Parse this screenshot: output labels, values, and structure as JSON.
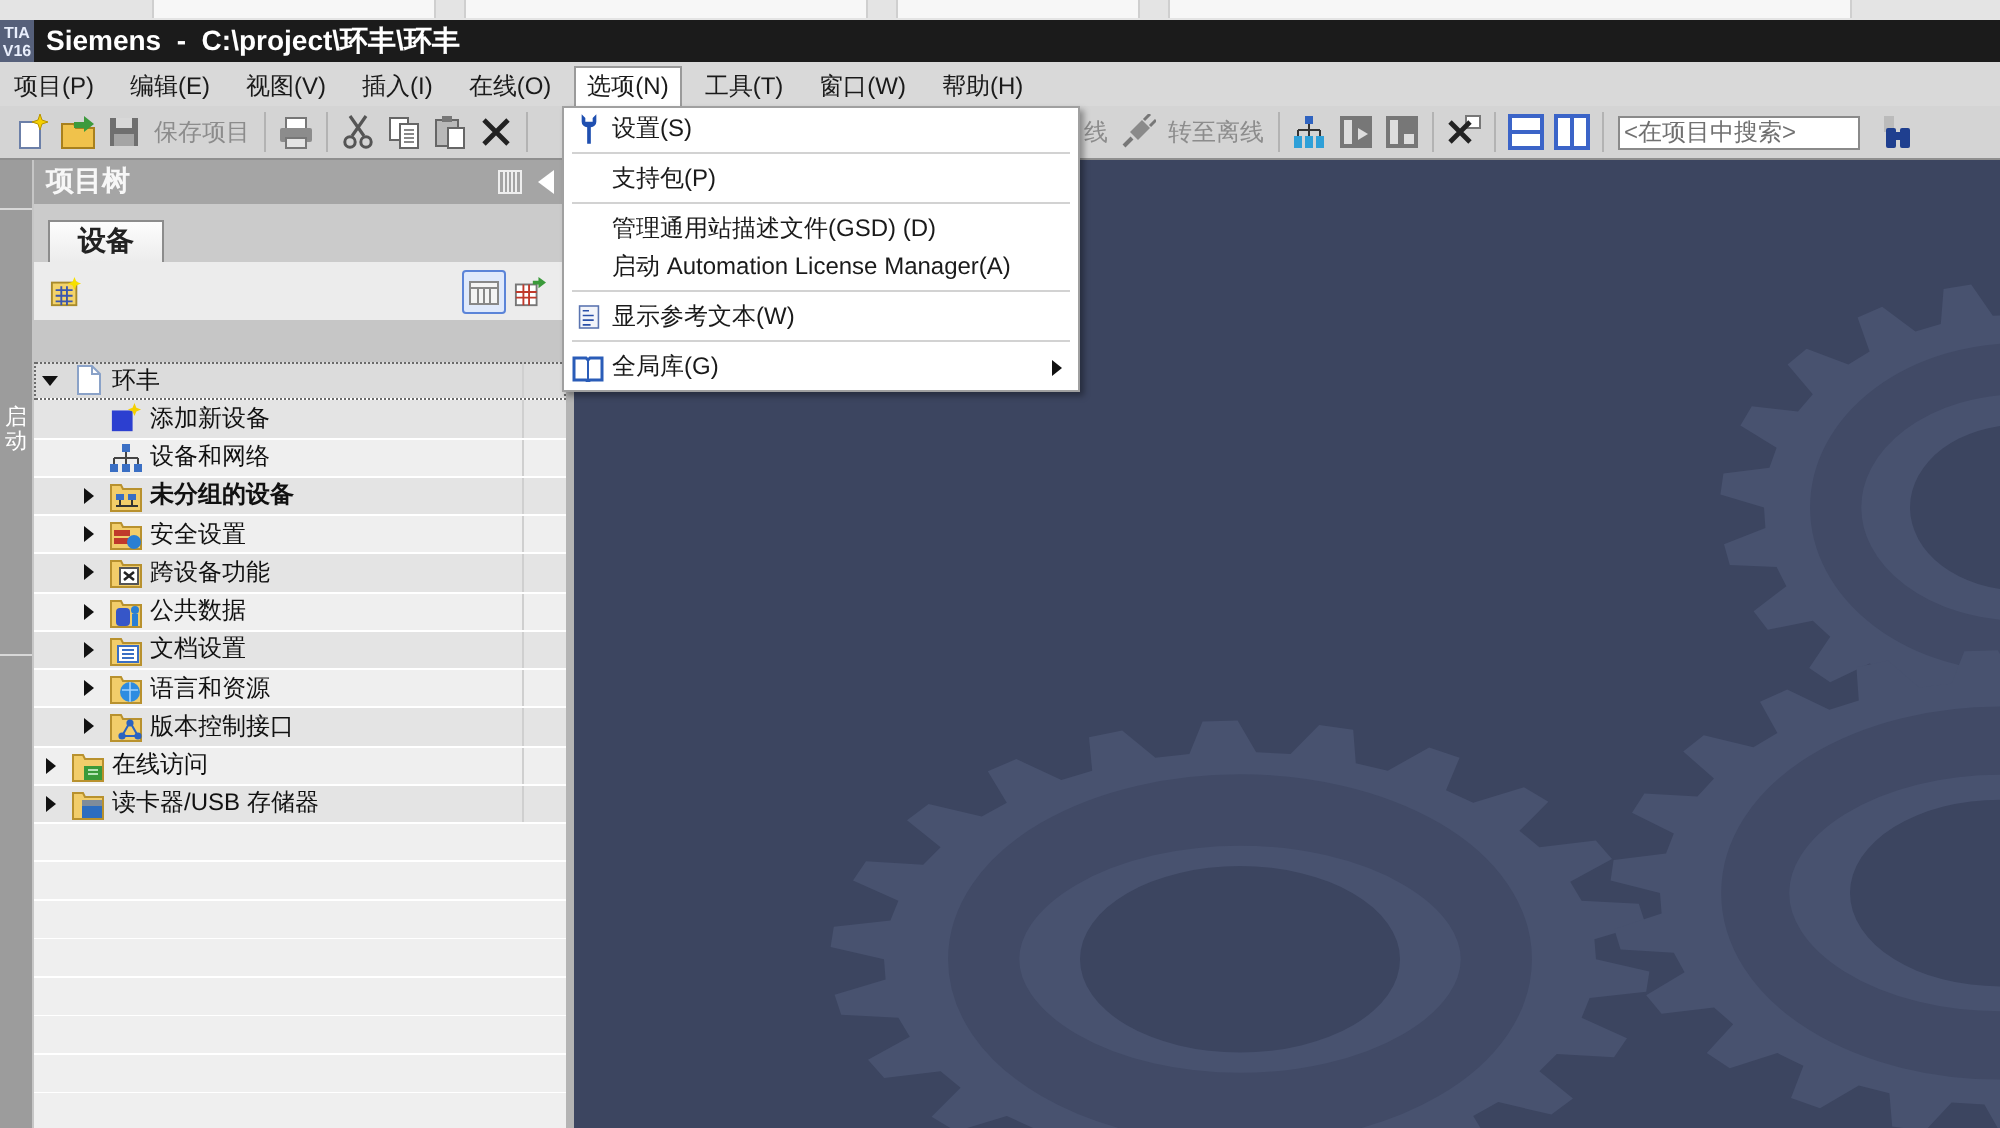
{
  "window": {
    "logo": [
      "TIA",
      "V16"
    ],
    "title": "Siemens  -  C:\\project\\环丰\\环丰"
  },
  "menu_bar": [
    {
      "label": "项目(P)",
      "selected": false
    },
    {
      "label": "编辑(E)",
      "selected": false
    },
    {
      "label": "视图(V)",
      "selected": false
    },
    {
      "label": "插入(I)",
      "selected": false
    },
    {
      "label": "在线(O)",
      "selected": false
    },
    {
      "label": "选项(N)",
      "selected": true
    },
    {
      "label": "工具(T)",
      "selected": false
    },
    {
      "label": "窗口(W)",
      "selected": false
    },
    {
      "label": "帮助(H)",
      "selected": false
    }
  ],
  "toolbar": {
    "buttons": [
      {
        "label": "保存项目",
        "disabled": true
      },
      {
        "label": "线",
        "disabled": true
      },
      {
        "label": "转至离线",
        "disabled": true
      }
    ],
    "search": {
      "placeholder": "<在项目中搜索>"
    }
  },
  "portal_strip": {
    "label": "启动"
  },
  "project_tree": {
    "title": "项目树",
    "tabs": [
      {
        "label": "设备",
        "selected": true
      }
    ],
    "view_button": {
      "selected": true
    },
    "tree": [
      {
        "label": "环丰",
        "kind": "project",
        "expanded": true,
        "focused": true,
        "bold": false,
        "children": [
          {
            "label": "添加新设备",
            "kind": "leaf",
            "focused": false,
            "bold": false
          },
          {
            "label": "设备和网络",
            "kind": "leaf",
            "focused": false,
            "bold": false
          },
          {
            "label": "未分组的设备",
            "kind": "folder",
            "expanded": false,
            "focused": false,
            "bold": true
          },
          {
            "label": "安全设置",
            "kind": "folder",
            "expanded": false,
            "focused": false,
            "bold": false
          },
          {
            "label": "跨设备功能",
            "kind": "folder",
            "expanded": false,
            "focused": false,
            "bold": false
          },
          {
            "label": "公共数据",
            "kind": "folder",
            "expanded": false,
            "focused": false,
            "bold": false
          },
          {
            "label": "文档设置",
            "kind": "folder",
            "expanded": false,
            "focused": false,
            "bold": false
          },
          {
            "label": "语言和资源",
            "kind": "folder",
            "expanded": false,
            "focused": false,
            "bold": false
          },
          {
            "label": "版本控制接口",
            "kind": "folder",
            "expanded": false,
            "focused": false,
            "bold": false
          }
        ]
      },
      {
        "label": "在线访问",
        "kind": "folder",
        "expanded": false,
        "focused": false,
        "bold": false
      },
      {
        "label": "读卡器/USB 存储器",
        "kind": "folder",
        "expanded": false,
        "focused": false,
        "bold": false
      }
    ]
  },
  "options_menu": {
    "groups": [
      {
        "items": [
          {
            "label": "设置(S)",
            "submenu": false
          }
        ]
      },
      {
        "items": [
          {
            "label": "支持包(P)",
            "submenu": false
          }
        ]
      },
      {
        "items": [
          {
            "label": "管理通用站描述文件(GSD) (D)",
            "submenu": false
          },
          {
            "label": "启动 Automation License Manager(A)",
            "submenu": false
          }
        ]
      },
      {
        "items": [
          {
            "label": "显示参考文本(W)",
            "submenu": false
          }
        ]
      },
      {
        "items": [
          {
            "label": "全局库(G)",
            "submenu": true
          }
        ]
      }
    ]
  }
}
